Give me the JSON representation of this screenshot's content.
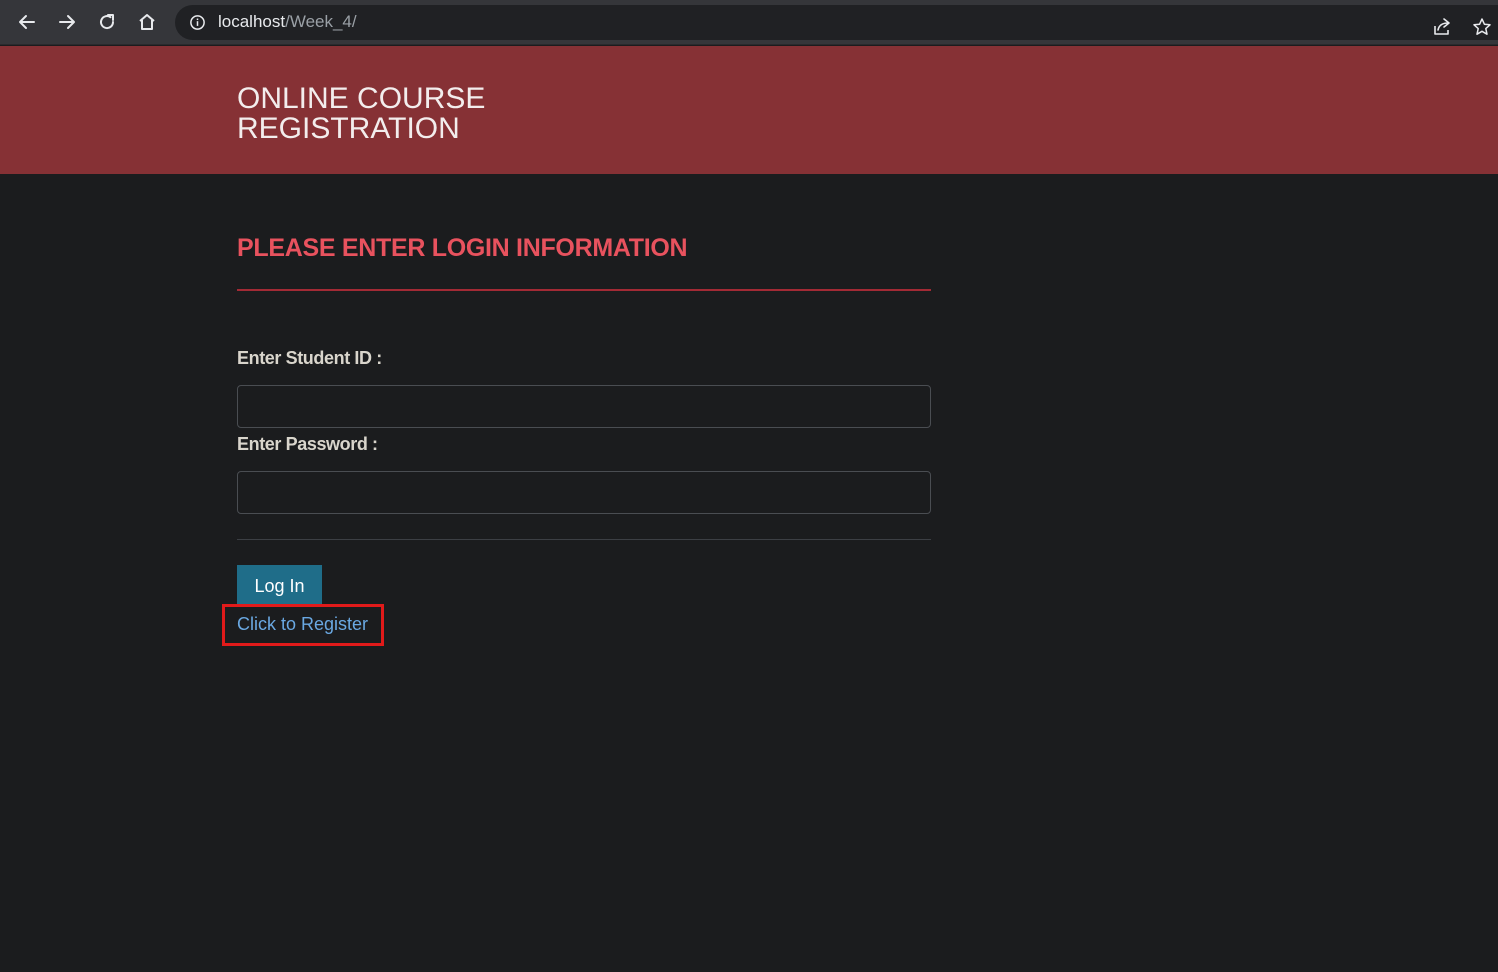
{
  "browser": {
    "url_host": "localhost",
    "url_path": "/Week_4/",
    "icons": [
      "back-arrow-icon",
      "forward-arrow-icon",
      "reload-icon",
      "home-icon",
      "site-info-icon",
      "share-icon",
      "bookmark-star-icon"
    ]
  },
  "header": {
    "title": "ONLINE COURSE REGISTRATION",
    "background": "#863135"
  },
  "form": {
    "heading": "PLEASE ENTER LOGIN INFORMATION",
    "heading_color": "#e8525e",
    "student_id_label": "Enter Student ID :",
    "student_id_value": "",
    "password_label": "Enter Password :",
    "password_value": "",
    "login_button": "Log In",
    "login_button_color": "#1f6d89",
    "register_link": "Click to Register",
    "register_link_color": "#6aa8e2",
    "highlight_color": "#e11a1a"
  }
}
